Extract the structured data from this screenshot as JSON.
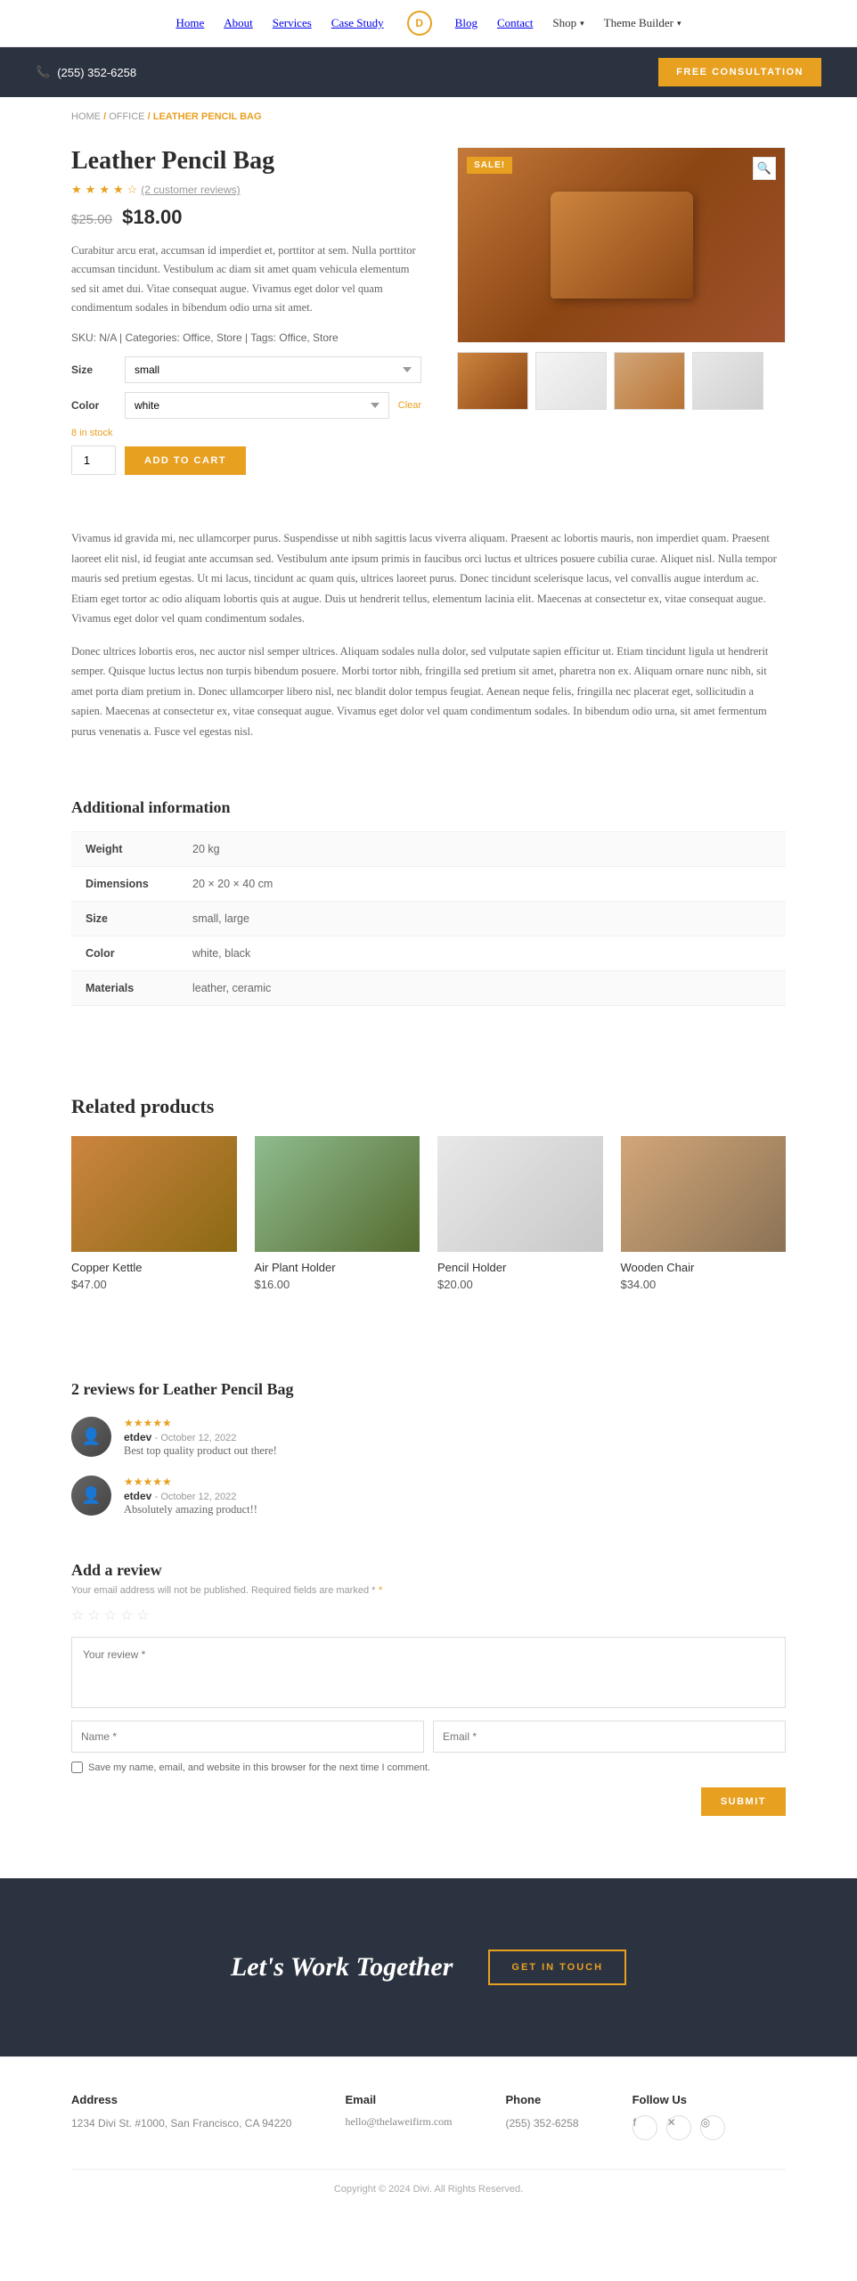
{
  "nav": {
    "links": [
      "Home",
      "About",
      "Services",
      "Case Study",
      "Blog",
      "Contact"
    ],
    "shop": "Shop",
    "theme_builder": "Theme Builder",
    "logo_letter": "D"
  },
  "header_bar": {
    "phone": "(255) 352-6258",
    "cta_label": "FREE CONSULTATION"
  },
  "breadcrumb": {
    "home": "HOME",
    "office": "OFFICE",
    "current": "LEATHER PENCIL BAG"
  },
  "product": {
    "sale_badge": "SALE!",
    "title": "Leather Pencil Bag",
    "review_count": "(2 customer reviews)",
    "old_price": "$25.00",
    "new_price": "$18.00",
    "description": "Curabitur arcu erat, accumsan id imperdiet et, porttitor at sem. Nulla porttitor accumsan tincidunt. Vestibulum ac diam sit amet quam vehicula elementum sed sit amet dui. Vitae consequat augue. Vivamus eget dolor vel quam condimentum sodales in bibendum odio urna sit amet.",
    "sku": "N/A",
    "categories": "Office, Store",
    "tags": "Office, Store",
    "size_label": "Size",
    "size_value": "small",
    "color_label": "Color",
    "color_value": "white",
    "clear_label": "Clear",
    "in_stock": "8 in stock",
    "qty_default": "1",
    "add_cart_label": "ADD TO CART",
    "long_desc_1": "Vivamus id gravida mi, nec ullamcorper purus. Suspendisse ut nibh sagittis lacus viverra aliquam. Praesent ac lobortis mauris, non imperdiet quam. Praesent laoreet elit nisl, id feugiat ante accumsan sed. Vestibulum ante ipsum primis in faucibus orci luctus et ultrices posuere cubilia curae. Aliquet nisl. Nulla tempor mauris sed pretium egestas. Ut mi lacus, tincidunt ac quam quis, ultrices laoreet purus. Donec tincidunt scelerisque lacus, vel convallis augue interdum ac. Etiam eget tortor ac odio aliquam lobortis quis at augue. Duis ut hendrerit tellus, elementum lacinia elit. Maecenas at consectetur ex, vitae consequat augue. Vivamus eget dolor vel quam condimentum sodales.",
    "long_desc_2": "Donec ultrices lobortis eros, nec auctor nisl semper ultrices. Aliquam sodales nulla dolor, sed vulputate sapien efficitur ut. Etiam tincidunt ligula ut hendrerit semper. Quisque luctus lectus non turpis bibendum posuere. Morbi tortor nibh, fringilla sed pretium sit amet, pharetra non ex. Aliquam ornare nunc nibh, sit amet porta diam pretium in. Donec ullamcorper libero nisl, nec blandit dolor tempus feugiat. Aenean neque felis, fringilla nec placerat eget, sollicitudin a sapien. Maecenas at consectetur ex, vitae consequat augue. Vivamus eget dolor vel quam condimentum sodales. In bibendum odio urna, sit amet fermentum purus venenatis a. Fusce vel egestas nisl.",
    "additional_info": {
      "title": "Additional information",
      "rows": [
        {
          "label": "Weight",
          "value": "20 kg"
        },
        {
          "label": "Dimensions",
          "value": "20 × 20 × 40 cm"
        },
        {
          "label": "Size",
          "value": "small, large"
        },
        {
          "label": "Color",
          "value": "white, black"
        },
        {
          "label": "Materials",
          "value": "leather, ceramic"
        }
      ]
    }
  },
  "related": {
    "title": "Related products",
    "products": [
      {
        "name": "Copper Kettle",
        "price": "$47.00",
        "img_class": "kettle"
      },
      {
        "name": "Air Plant Holder",
        "price": "$16.00",
        "img_class": "plant"
      },
      {
        "name": "Pencil Holder",
        "price": "$20.00",
        "img_class": "pencil"
      },
      {
        "name": "Wooden Chair",
        "price": "$34.00",
        "img_class": "chair"
      }
    ]
  },
  "reviews": {
    "title": "2 reviews for Leather Pencil Bag",
    "items": [
      {
        "reviewer": "etdev",
        "date": "October 12, 2022",
        "text": "Best top quality product out there!",
        "stars": 5
      },
      {
        "reviewer": "etdev",
        "date": "October 12, 2022",
        "text": "Absolutely amazing product!!",
        "stars": 5
      }
    ],
    "add_title": "Add a review",
    "add_note": "Your email address will not be published. Required fields are marked *",
    "textarea_placeholder": "Your review *",
    "name_placeholder": "Name *",
    "email_placeholder": "Email *",
    "save_label": "Save my name, email, and website in this browser for the next time I comment.",
    "submit_label": "SUBMIT"
  },
  "cta": {
    "title": "Let's Work Together",
    "btn_label": "GET IN TOUCH"
  },
  "footer": {
    "address_title": "Address",
    "address_text": "1234 Divi St. #1000, San Francisco, CA 94220",
    "email_title": "Email",
    "email_text": "hello@thelaweifirm.com",
    "phone_title": "Phone",
    "phone_text": "(255) 352-6258",
    "follow_title": "Follow Us",
    "social": [
      "f",
      "𝕏",
      "📷"
    ],
    "copyright": "Copyright © 2024 Divi. All Rights Reserved."
  }
}
